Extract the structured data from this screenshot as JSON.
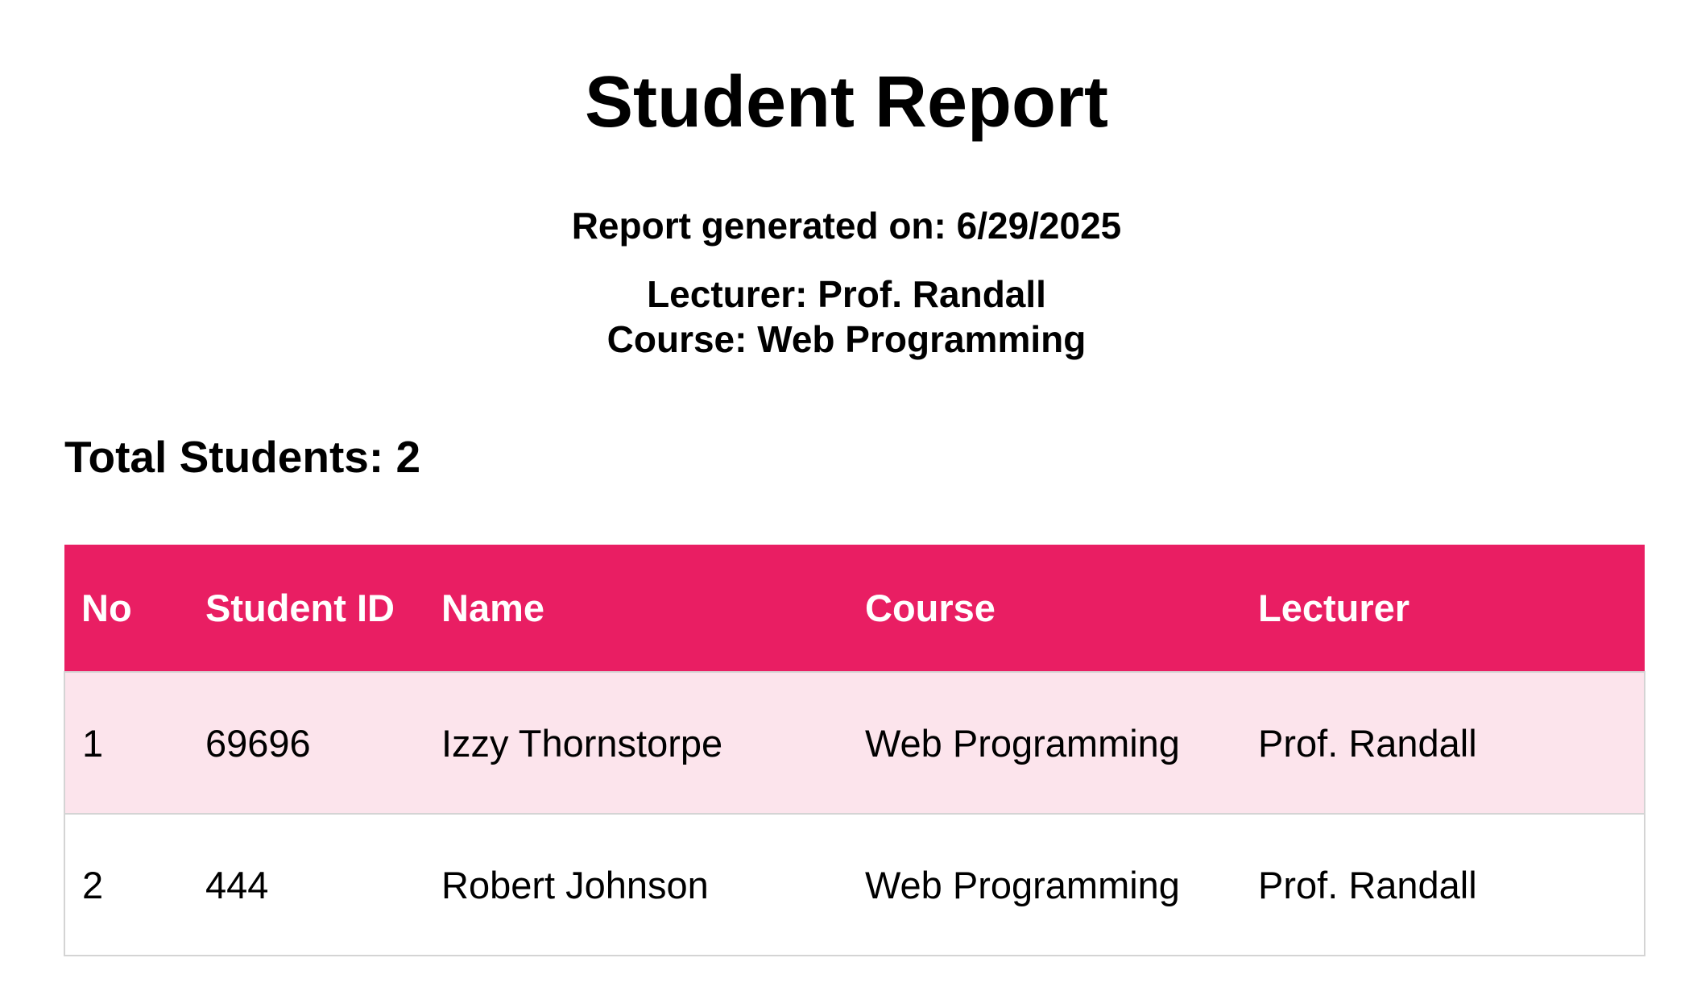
{
  "report": {
    "title": "Student Report",
    "generated": "Report generated on: 6/29/2025",
    "lecturer": "Lecturer: Prof. Randall",
    "course": "Course: Web Programming",
    "total": "Total Students: 2"
  },
  "table": {
    "headers": {
      "no": "No",
      "student_id": "Student ID",
      "name": "Name",
      "course": "Course",
      "lecturer": "Lecturer"
    },
    "rows": [
      {
        "no": "1",
        "student_id": "69696",
        "name": "Izzy Thornstorpe",
        "course": "Web Programming",
        "lecturer": "Prof. Randall"
      },
      {
        "no": "2",
        "student_id": "444",
        "name": "Robert Johnson",
        "course": "Web Programming",
        "lecturer": "Prof. Randall"
      }
    ]
  },
  "colors": {
    "header_bg": "#e91e63",
    "odd_row_bg": "#fce4ec",
    "even_row_bg": "#ffffff",
    "header_text": "#ffffff"
  }
}
